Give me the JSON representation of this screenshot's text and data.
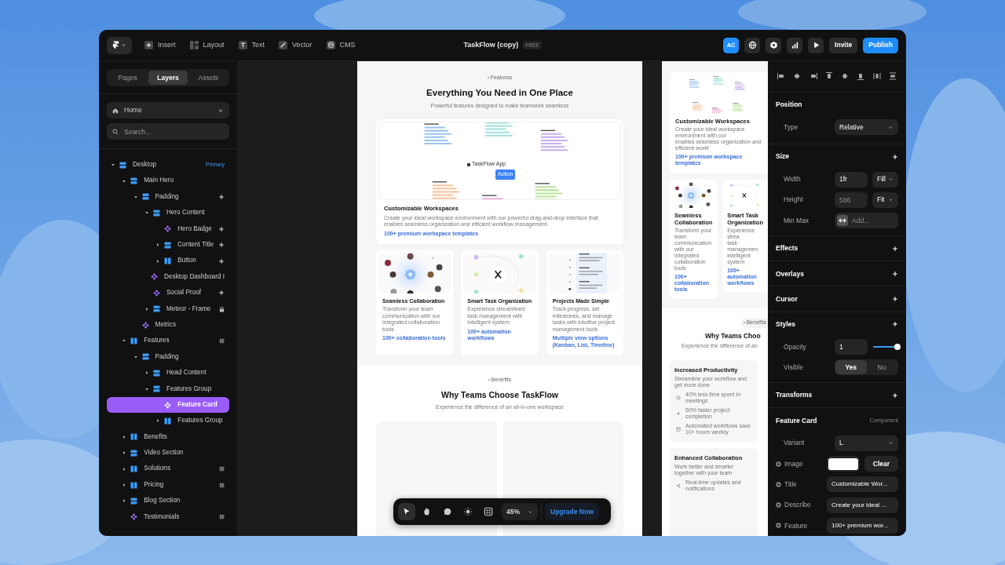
{
  "topbar": {
    "tools": [
      {
        "kind": "insert",
        "label": "Insert"
      },
      {
        "kind": "layout",
        "label": "Layout"
      },
      {
        "kind": "text",
        "label": "Text"
      },
      {
        "kind": "vector",
        "label": "Vector"
      },
      {
        "kind": "cms",
        "label": "CMS"
      }
    ],
    "file_title": "TaskFlow (copy)",
    "plan_badge": "FREE",
    "avatar": "AC",
    "actions": [
      {
        "kind": "globe"
      },
      {
        "kind": "hexagon"
      },
      {
        "kind": "chart"
      },
      {
        "kind": "play"
      }
    ],
    "invite": "Invite",
    "publish": "Publish"
  },
  "left_panel": {
    "tabs": [
      {
        "label": "Pages",
        "selected": false
      },
      {
        "label": "Layers",
        "selected": true
      },
      {
        "label": "Assets",
        "selected": false
      }
    ],
    "page_select": "Home",
    "search": {
      "placeholder": "Search..."
    },
    "layers": [
      {
        "name": "Desktop",
        "kind": "stack",
        "expandable": true,
        "expanded": true,
        "selected": false,
        "badge": "Primary",
        "children": [
          {
            "name": "Main Hero",
            "kind": "stack",
            "expandable": true,
            "expanded": true,
            "selected": false,
            "children": [
              {
                "name": "Padding",
                "kind": "stack",
                "expandable": true,
                "expanded": true,
                "selected": false,
                "trailing": {
                  "kind": "plus"
                },
                "children": [
                  {
                    "name": "Hero Content",
                    "kind": "stack",
                    "expandable": true,
                    "expanded": true,
                    "selected": false,
                    "children": [
                      {
                        "name": "Hero Badge",
                        "kind": "component",
                        "expandable": false,
                        "selected": false,
                        "trailing": {
                          "kind": "plus"
                        }
                      },
                      {
                        "name": "Content Title",
                        "kind": "stack",
                        "expandable": true,
                        "expanded": false,
                        "selected": false,
                        "trailing": {
                          "kind": "plus"
                        }
                      },
                      {
                        "name": "Button",
                        "kind": "columns",
                        "expandable": true,
                        "expanded": false,
                        "selected": false,
                        "trailing": {
                          "kind": "plus"
                        }
                      }
                    ]
                  },
                  {
                    "name": "Desktop Dashboard I",
                    "kind": "component",
                    "expandable": false,
                    "selected": false
                  },
                  {
                    "name": "Social Proof",
                    "kind": "component",
                    "expandable": false,
                    "selected": false,
                    "trailing": {
                      "kind": "plus"
                    }
                  },
                  {
                    "name": "Meteor - Frame",
                    "kind": "stack",
                    "expandable": true,
                    "expanded": false,
                    "selected": false,
                    "trailing": {
                      "kind": "lock"
                    }
                  }
                ]
              },
              {
                "name": "Metrics",
                "kind": "component",
                "expandable": false,
                "selected": false
              }
            ]
          },
          {
            "name": "Features",
            "kind": "columns",
            "expandable": true,
            "expanded": true,
            "selected": false,
            "trailing": {
              "kind": "hash"
            },
            "children": [
              {
                "name": "Padding",
                "kind": "stack",
                "expandable": true,
                "expanded": true,
                "selected": false,
                "children": [
                  {
                    "name": "Head Content",
                    "kind": "stack",
                    "expandable": true,
                    "expanded": false,
                    "selected": false
                  },
                  {
                    "name": "Features Group",
                    "kind": "stack",
                    "expandable": true,
                    "expanded": true,
                    "selected": false,
                    "children": [
                      {
                        "name": "Feature Card",
                        "kind": "component",
                        "expandable": false,
                        "selected": true
                      },
                      {
                        "name": "Features Group",
                        "kind": "columns",
                        "expandable": true,
                        "expanded": false,
                        "selected": false
                      }
                    ]
                  }
                ]
              }
            ]
          },
          {
            "name": "Benefits",
            "kind": "columns",
            "expandable": true,
            "expanded": false,
            "selected": false
          },
          {
            "name": "Video Section",
            "kind": "stack",
            "expandable": true,
            "expanded": false,
            "selected": false
          },
          {
            "name": "Solutions",
            "kind": "columns",
            "expandable": true,
            "expanded": false,
            "selected": false,
            "trailing": {
              "kind": "hash"
            }
          },
          {
            "name": "Pricing",
            "kind": "columns",
            "expandable": true,
            "expanded": false,
            "selected": false,
            "trailing": {
              "kind": "hash"
            }
          },
          {
            "name": "Blog Section",
            "kind": "stack",
            "expandable": true,
            "expanded": false,
            "selected": false
          },
          {
            "name": "Testimonials",
            "kind": "component",
            "expandable": false,
            "selected": false,
            "trailing": {
              "kind": "hash"
            }
          }
        ]
      }
    ]
  },
  "canvas": {
    "desktop_frame": {
      "features": {
        "eyebrow": "Features",
        "heading": "Everything You Need in One Place",
        "subtitle": "Powerful features designed to make teamwork seamless",
        "board": {
          "app_label": "TaskFlow App",
          "action_label": "Action"
        },
        "cards": [
          {
            "kind": "workspace",
            "title": "Customizable Workspaces",
            "description": "Create your ideal workspace environment with our powerful drag-and-drop interface that enables seamless organization and efficient workflow management.",
            "link": "100+ premium workspace templates"
          },
          {
            "kind": "collaboration",
            "title": "Seamless Collaboration",
            "description": "Transform your team communication with our integrated collaboration tools",
            "link": "100+ collaboration tools"
          },
          {
            "kind": "tasks",
            "title": "Smart Task Organization",
            "description": "Experience streamlined task management with intelligent system",
            "link": "100+ automation workflows"
          },
          {
            "kind": "projects",
            "title": "Projects Made Simple",
            "description": "Track progress, set milestones, and manage tasks with intuitive project management tools",
            "link": "Multiple view options (Kanban, List, Timeline)"
          }
        ]
      },
      "benefits": {
        "eyebrow": "Benefits",
        "heading": "Why Teams Choose TaskFlow",
        "subtitle": "Experience the difference of an all-in-one workspace"
      }
    },
    "tablet_frame": {
      "cards": [
        {
          "kind": "workspace",
          "title": "Customizable Workspaces",
          "description_lines": [
            "Create your ideal workspace environment with our",
            "enables seamless organization and efficient workf"
          ],
          "link": "100+ premium workspace templates"
        },
        {
          "kind": "collaboration",
          "title": "Seamless Collaboration",
          "description_lines": [
            "Transform your team communication with our integrated collaboration tools"
          ],
          "link": "100+ collaboration tools"
        },
        {
          "kind": "tasks",
          "title": "Smart Task Organization",
          "description_lines": [
            "Experience strea",
            "task managemen",
            "intelligent system"
          ],
          "link": "100+ automation workflows"
        }
      ],
      "benefits": {
        "eyebrow": "Benefits",
        "heading": "Why Teams Choo",
        "subtitle": "Experience the difference of an",
        "cards": [
          {
            "title": "Increased Productivity",
            "description": "Streamline your workflow and get more done",
            "points": [
              {
                "kind": "clock",
                "text": "40% less time spent in meetings"
              },
              {
                "kind": "sparkle",
                "text": "50% faster project completion"
              },
              {
                "kind": "calendar",
                "text": "Automated workflows save 10+ hours weekly"
              }
            ]
          },
          {
            "title": "Enhanced Collaboration",
            "description": "Work better and smarter together with your team",
            "points": [
              {
                "kind": "share",
                "text": "Real-time updates and notifications"
              }
            ]
          }
        ]
      }
    },
    "bottom_toolbar": {
      "tools": [
        {
          "kind": "pointer",
          "selected": true
        },
        {
          "kind": "hand",
          "selected": false
        },
        {
          "kind": "comment",
          "selected": false
        },
        {
          "kind": "sun",
          "selected": false
        },
        {
          "kind": "grid",
          "selected": false
        }
      ],
      "zoom": "45%",
      "upgrade": "Upgrade Now"
    }
  },
  "inspector": {
    "position": {
      "title": "Position",
      "type_label": "Type",
      "type_value": "Relative"
    },
    "size": {
      "title": "Size",
      "width_label": "Width",
      "width_value": "1fr",
      "width_mode": "Fill",
      "height_label": "Height",
      "height_placeholder": "586",
      "height_mode": "Fit",
      "minmax_label": "Min Max",
      "minmax_placeholder": "Add..."
    },
    "sections": [
      {
        "title": "Effects"
      },
      {
        "title": "Overlays"
      },
      {
        "title": "Cursor"
      }
    ],
    "styles": {
      "title": "Styles",
      "opacity_label": "Opacity",
      "opacity_value": "1",
      "opacity_slider": {
        "level": 1
      },
      "visible_label": "Visible",
      "options": [
        {
          "label": "Yes",
          "selected": true
        },
        {
          "label": "No",
          "selected": false
        }
      ]
    },
    "transforms": {
      "title": "Transforms"
    },
    "component": {
      "title": "Feature Card",
      "tag": "Component",
      "variant_label": "Variant",
      "variant_value": "L",
      "fields": [
        {
          "kind": "image",
          "label": "Image",
          "button": "Clear"
        },
        {
          "kind": "text",
          "label": "Title",
          "value": "Customizable Wor..."
        },
        {
          "kind": "text",
          "label": "Describe",
          "value": "Create your ideal ..."
        },
        {
          "kind": "text",
          "label": "Feature",
          "value": "100+ premium wor..."
        }
      ]
    }
  }
}
